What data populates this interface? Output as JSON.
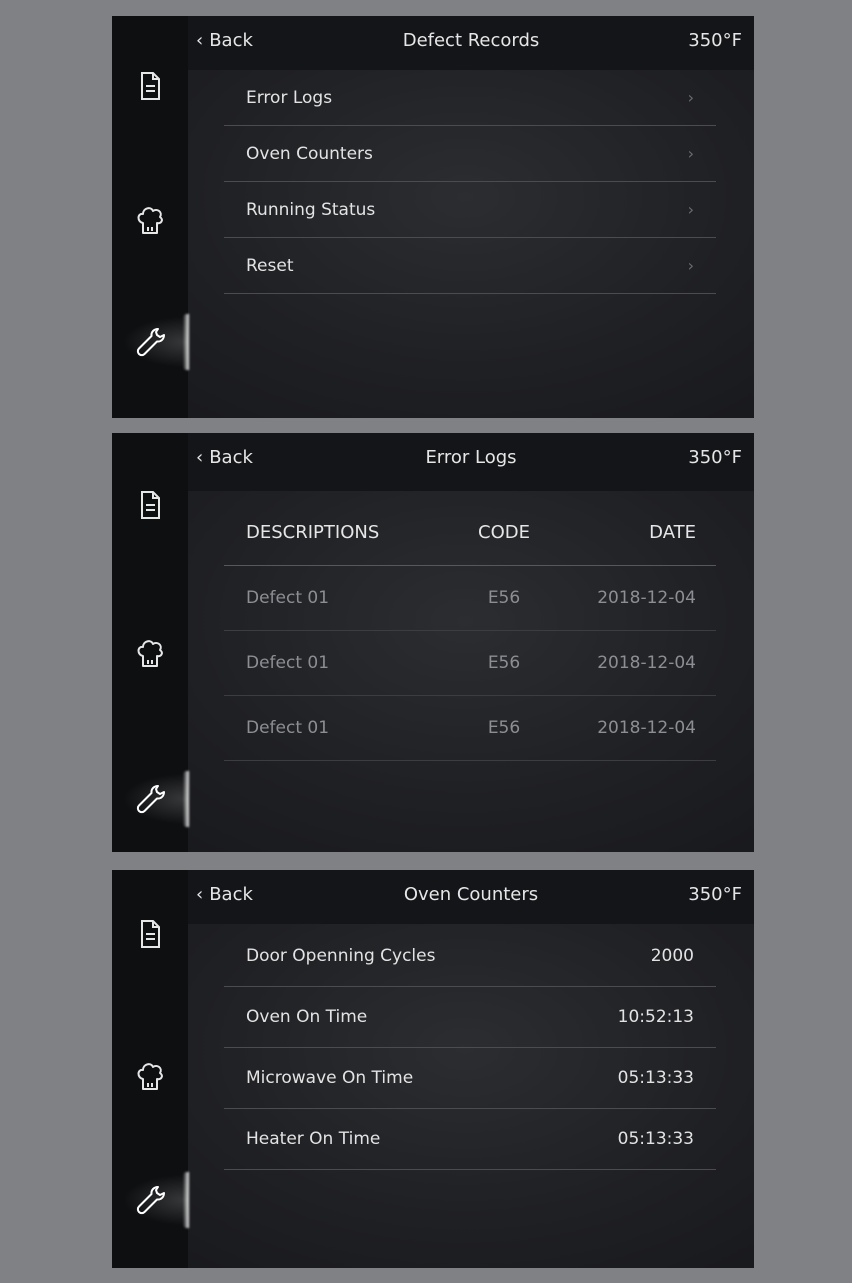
{
  "icons": {
    "records": "document-icon",
    "cooking": "chef-hat-icon",
    "service": "wrench-icon"
  },
  "colors": {
    "page_bg": "#808185",
    "screen_bg": "#1f2024",
    "text": "#e6e6e6",
    "muted_text": "#8c8e93"
  },
  "screens": [
    {
      "back_label": "Back",
      "title": "Defect Records",
      "temperature": "350°F",
      "menu": [
        {
          "label": "Error Logs"
        },
        {
          "label": "Oven Counters"
        },
        {
          "label": "Running Status"
        },
        {
          "label": "Reset"
        }
      ]
    },
    {
      "back_label": "Back",
      "title": "Error Logs",
      "temperature": "350°F",
      "table": {
        "columns": [
          "DESCRIPTIONS",
          "CODE",
          "DATE"
        ],
        "rows": [
          [
            "Defect 01",
            "E56",
            "2018-12-04"
          ],
          [
            "Defect 01",
            "E56",
            "2018-12-04"
          ],
          [
            "Defect 01",
            "E56",
            "2018-12-04"
          ]
        ]
      }
    },
    {
      "back_label": "Back",
      "title": "Oven Counters",
      "temperature": "350°F",
      "counters": [
        {
          "label": "Door Openning Cycles",
          "value": "2000"
        },
        {
          "label": "Oven On Time",
          "value": "10:52:13"
        },
        {
          "label": "Microwave On Time",
          "value": "05:13:33"
        },
        {
          "label": "Heater On Time",
          "value": "05:13:33"
        }
      ]
    }
  ]
}
